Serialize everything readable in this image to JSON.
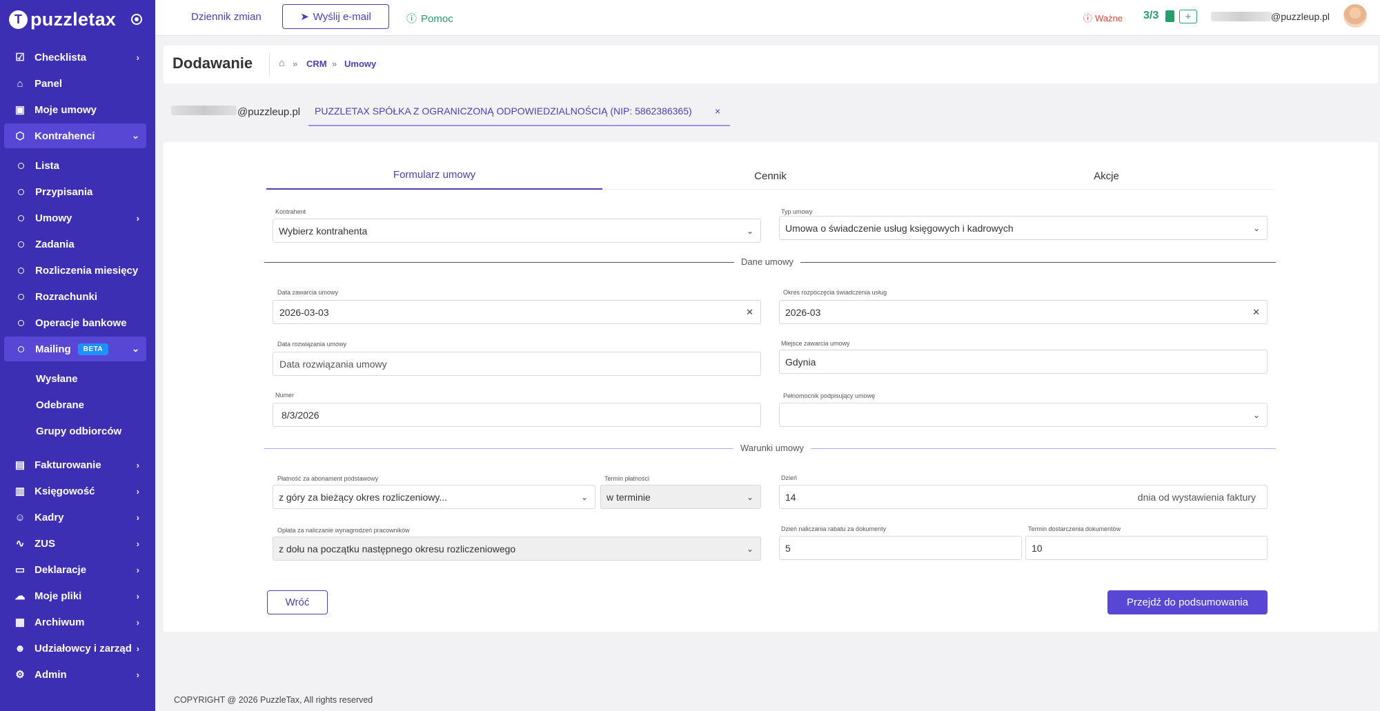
{
  "sidebar": {
    "logo_text": "puzzletax",
    "items": [
      {
        "label": "Checklista",
        "icon": "checkbox-icon"
      },
      {
        "label": "Panel",
        "icon": "home-icon"
      },
      {
        "label": "Moje umowy",
        "icon": "briefcase-icon"
      },
      {
        "label": "Kontrahenci",
        "icon": "cube-icon"
      }
    ],
    "kontrahenci_sub": [
      "Lista",
      "Przypisania",
      "Umowy",
      "Zadania",
      "Rozliczenia miesięcy",
      "Rozrachunki",
      "Operacje bankowe"
    ],
    "mailing": {
      "label": "Mailing",
      "badge": "BETA",
      "sub": [
        "Wysłane",
        "Odebrane",
        "Grupy odbiorców"
      ]
    },
    "bottom_items": [
      {
        "label": "Fakturowanie",
        "icon": "invoice-icon"
      },
      {
        "label": "Księgowość",
        "icon": "ledger-icon"
      },
      {
        "label": "Kadry",
        "icon": "people-icon"
      },
      {
        "label": "ZUS",
        "icon": "pulse-icon"
      },
      {
        "label": "Deklaracje",
        "icon": "book-icon"
      },
      {
        "label": "Moje pliki",
        "icon": "upload-icon"
      },
      {
        "label": "Archiwum",
        "icon": "archive-icon"
      },
      {
        "label": "Udziałowcy i zarząd",
        "icon": "users-icon"
      },
      {
        "label": "Admin",
        "icon": "gear-icon"
      }
    ]
  },
  "topbar": {
    "changelog": "Dziennik zmian",
    "send_email": "Wyślij e-mail",
    "help": "Pomoc",
    "important": "Ważne",
    "count": "3/3",
    "plus": "+",
    "user_email": "@puzzleup.pl"
  },
  "header": {
    "title": "Dodawanie",
    "breadcrumb": [
      "CRM",
      "Umowy"
    ]
  },
  "context": {
    "email": "@puzzleup.pl",
    "company": "PUZZLETAX SPÓŁKA Z OGRANICZONĄ ODPOWIEDZIALNOŚCIĄ (NIP: 5862386365)",
    "close": "×"
  },
  "tabs": [
    "Formularz umowy",
    "Cennik",
    "Akcje"
  ],
  "form": {
    "kontrahent": {
      "label": "Kontrahent",
      "value": "Wybierz kontrahenta"
    },
    "typ_umowy": {
      "label": "Typ umowy",
      "value": "Umowa o świadczenie usług księgowych i kadrowych"
    },
    "section_dane": "Dane umowy",
    "data_zawarcia": {
      "label": "Data zawarcia umowy",
      "value": "2026-03-03"
    },
    "okres_rozpoczecia": {
      "label": "Okres rozpoczęcia świadczenia usług",
      "value": "2026-03"
    },
    "data_rozwiazania": {
      "label": "Data rozwiązania umowy",
      "placeholder": "Data rozwiązania umowy"
    },
    "miejsce_zawarcia": {
      "label": "Miejsce zawarcia umowy",
      "value": "Gdynia"
    },
    "numer": {
      "label": "Numer",
      "value": "8/3/2026"
    },
    "pelnomocnik": {
      "label": "Pełnomocnik podpisujący umowę",
      "value": ""
    },
    "section_warunki": "Warunki umowy",
    "platnosc": {
      "label": "Płatność za abonament podstawowy",
      "value": "z góry za bieżący okres rozliczeniowy..."
    },
    "termin_platnosci": {
      "label": "Termin płatności",
      "value": "w terminie"
    },
    "dzien": {
      "label": "Dzień",
      "value": "14",
      "suffix": "dnia od wystawienia faktury"
    },
    "oplata": {
      "label": "Opłata za naliczanie wynagrodzeń pracowników",
      "value": "z dołu na początku następnego okresu rozliczeniowego"
    },
    "dzien_rabatu": {
      "label": "Dzień naliczania rabatu za dokumenty",
      "value": "5"
    },
    "termin_dostarczenia": {
      "label": "Termin dostarczenia dokumentów",
      "value": "10"
    }
  },
  "buttons": {
    "back": "Wróć",
    "next": "Przejdź do podsumowania"
  },
  "footer": "COPYRIGHT @ 2026 PuzzleTax, All rights reserved",
  "colors": {
    "sidebar": "#3d2fb4",
    "accent": "#5747d4",
    "green": "#21a06a",
    "danger": "#e0463c"
  }
}
